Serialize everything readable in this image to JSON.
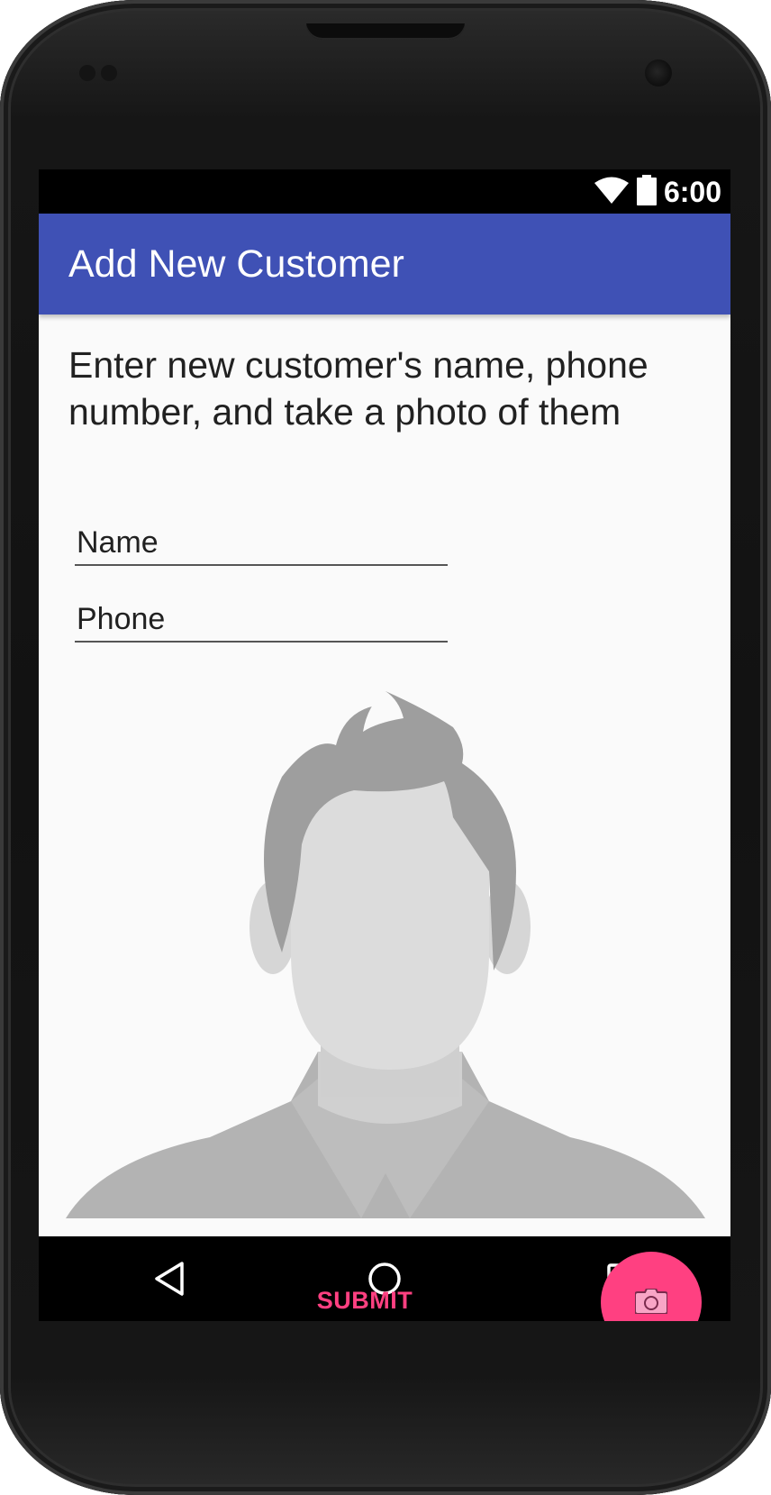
{
  "status_bar": {
    "time": "6:00",
    "icons": [
      "wifi-icon",
      "battery-icon"
    ]
  },
  "app_bar": {
    "title": "Add New Customer"
  },
  "main": {
    "instructions": "Enter new customer's name, phone number, and take a photo of them",
    "name_field": {
      "placeholder": "Name",
      "value": ""
    },
    "phone_field": {
      "placeholder": "Phone",
      "value": ""
    },
    "photo_placeholder": "default-avatar-silhouette",
    "submit_label": "SUBMIT",
    "fab_icon": "camera-icon"
  },
  "nav_bar": {
    "buttons": [
      "back-icon",
      "home-icon",
      "recents-icon"
    ]
  },
  "colors": {
    "primary": "#3f51b5",
    "accent": "#ff4081",
    "background": "#fafafa",
    "text": "#212121"
  }
}
